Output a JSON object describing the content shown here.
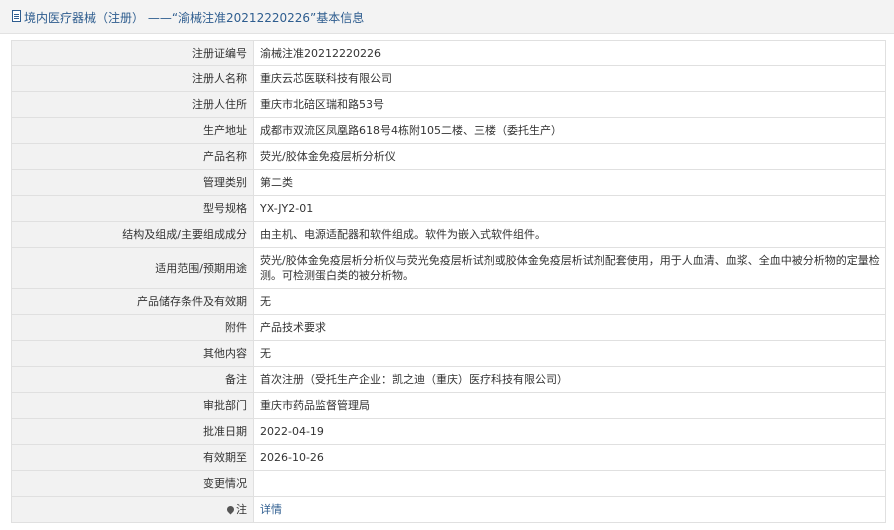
{
  "header": {
    "title": "境内医疗器械（注册） ——“渝械注准20212220226”基本信息"
  },
  "rows": [
    {
      "label": "注册证编号",
      "value": "渝械注准20212220226"
    },
    {
      "label": "注册人名称",
      "value": "重庆云芯医联科技有限公司"
    },
    {
      "label": "注册人住所",
      "value": "重庆市北碚区瑞和路53号"
    },
    {
      "label": "生产地址",
      "value": "成都市双流区凤凰路618号4栋附105二楼、三楼（委托生产）"
    },
    {
      "label": "产品名称",
      "value": "荧光/胶体金免疫层析分析仪"
    },
    {
      "label": "管理类别",
      "value": "第二类"
    },
    {
      "label": "型号规格",
      "value": "YX-JY2-01"
    },
    {
      "label": "结构及组成/主要组成成分",
      "value": "由主机、电源适配器和软件组成。软件为嵌入式软件组件。"
    },
    {
      "label": "适用范围/预期用途",
      "value": "荧光/胶体金免疫层析分析仪与荧光免疫层析试剂或胶体金免疫层析试剂配套使用，用于人血清、血浆、全血中被分析物的定量检测。可检测蛋白类的被分析物。"
    },
    {
      "label": "产品储存条件及有效期",
      "value": "无"
    },
    {
      "label": "附件",
      "value": "产品技术要求"
    },
    {
      "label": "其他内容",
      "value": "无"
    },
    {
      "label": "备注",
      "value": "首次注册（受托生产企业：凯之迪（重庆）医疗科技有限公司）"
    },
    {
      "label": "审批部门",
      "value": "重庆市药品监督管理局"
    },
    {
      "label": "批准日期",
      "value": "2022-04-19"
    },
    {
      "label": "有效期至",
      "value": "2026-10-26"
    },
    {
      "label": "变更情况",
      "value": ""
    }
  ],
  "note": {
    "label": "注",
    "link": "详情"
  }
}
